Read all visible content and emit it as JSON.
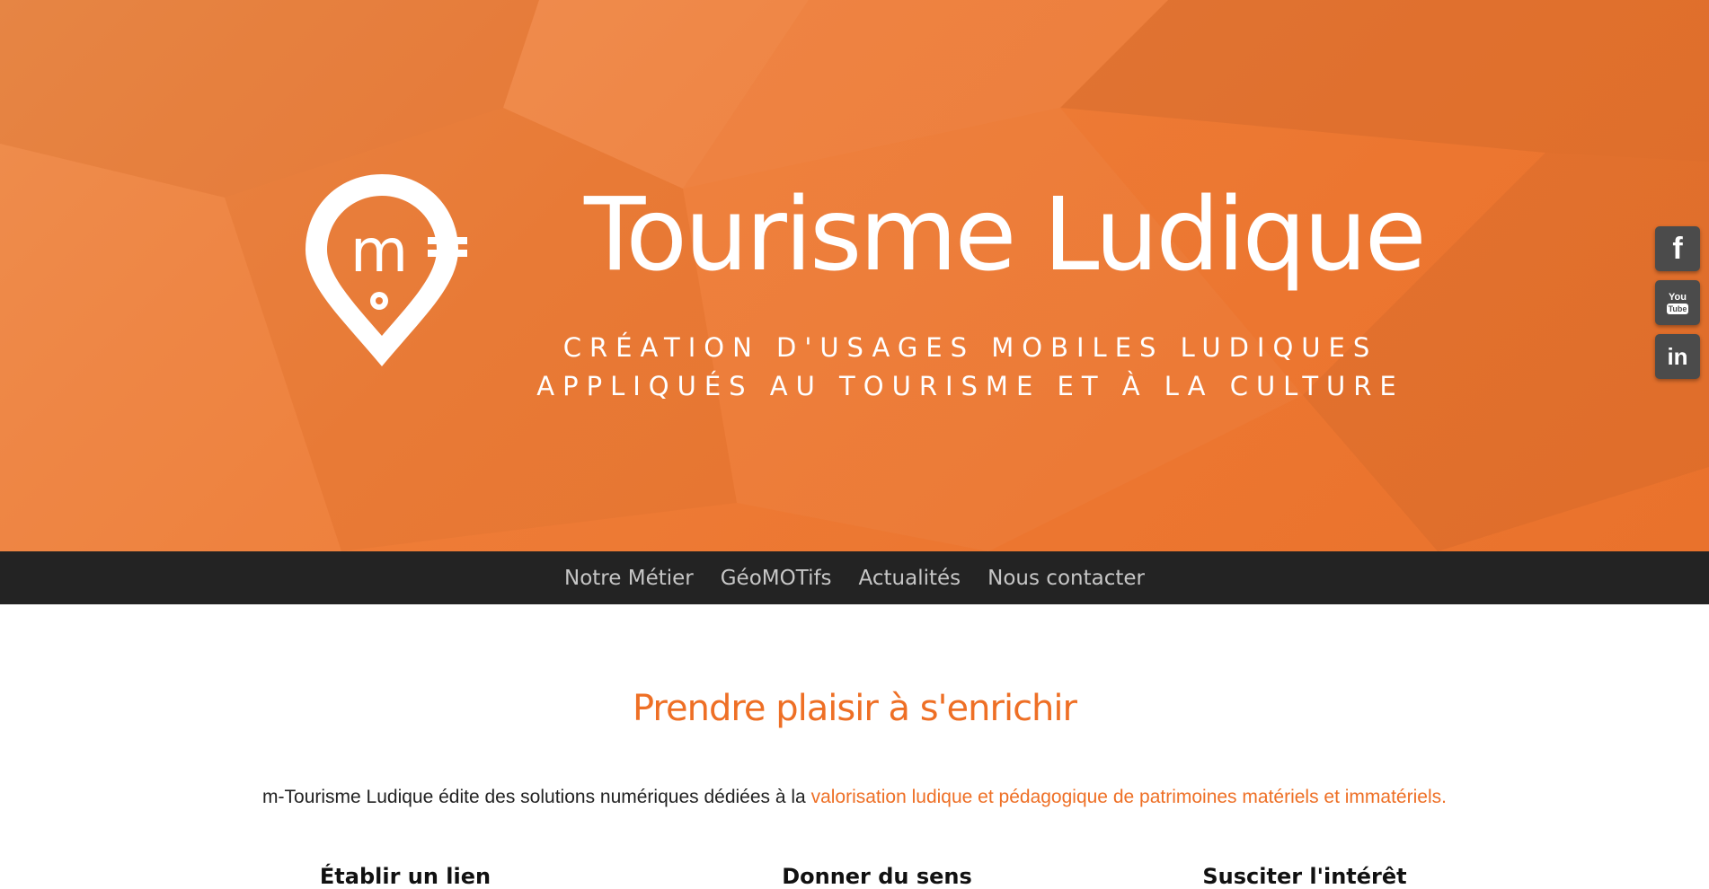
{
  "header": {
    "title": "Tourisme Ludique",
    "tagline_lines": [
      "CRÉATION D'USAGES MOBILES LUDIQUES",
      "APPLIQUÉS AU TOURISME ET À LA CULTURE"
    ],
    "logo": {
      "letter": "m",
      "icon": "map-pin-logo-icon"
    }
  },
  "social": [
    {
      "name": "facebook-icon",
      "label": "f"
    },
    {
      "name": "youtube-icon",
      "label_top": "You",
      "label_bottom": "Tube"
    },
    {
      "name": "linkedin-icon",
      "label": "in"
    }
  ],
  "nav": {
    "items": [
      "Notre Métier",
      "GéoMOTifs",
      "Actualités",
      "Nous contacter"
    ]
  },
  "main": {
    "title": "Prendre plaisir à s'enrichir",
    "intro_text": "m-Tourisme Ludique édite des solutions numériques dédiées à la ",
    "intro_highlight": "valorisation ludique et pédagogique de patrimoines matériels et immatériels.",
    "features": [
      "Établir un lien",
      "Donner du sens",
      "Susciter l'intérêt"
    ]
  },
  "colors": {
    "hero_orange": "#ee7d38",
    "accent": "#ee6f25",
    "navbar_bg": "#232323",
    "nav_text": "#c6c6c6",
    "social_bg": "#4b4b4b"
  }
}
